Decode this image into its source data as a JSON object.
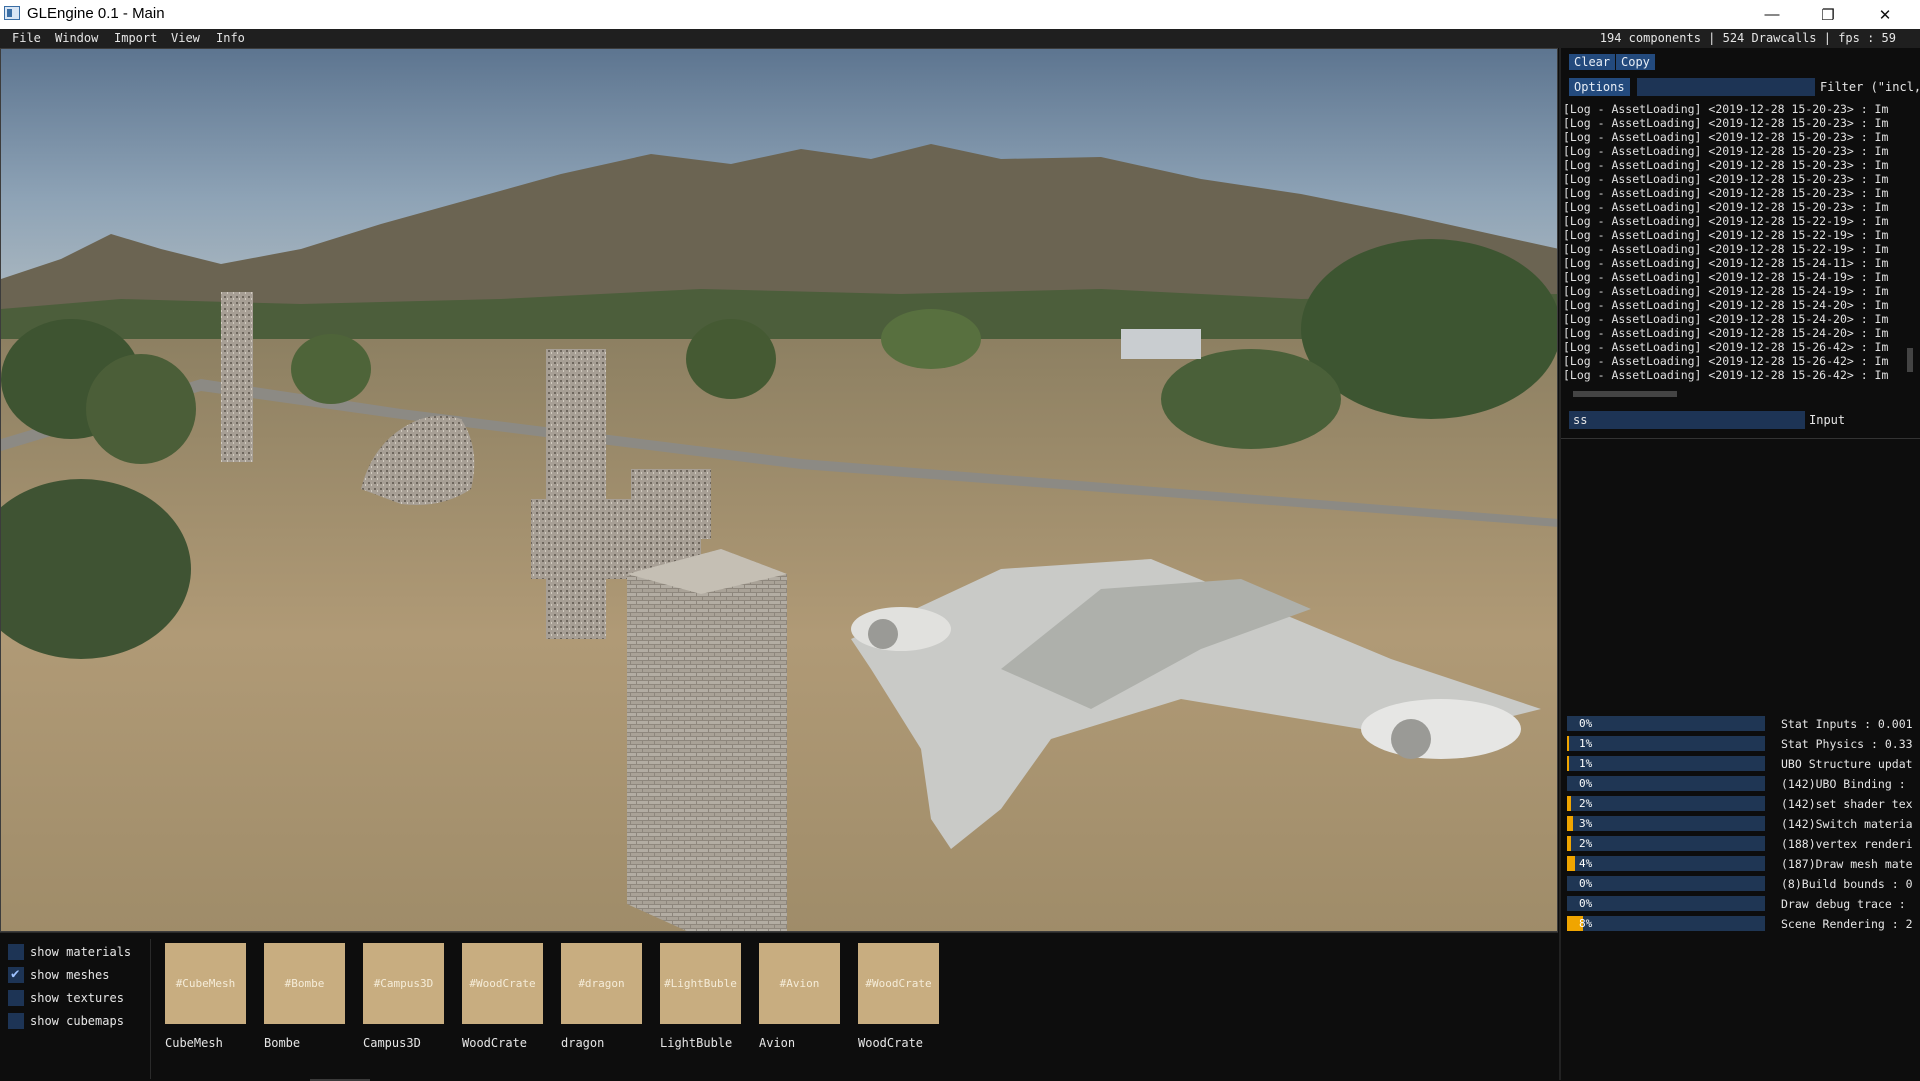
{
  "window": {
    "title": "GLEngine 0.1 - Main",
    "minimize_glyph": "—",
    "maximize_glyph": "❐",
    "close_glyph": "✕"
  },
  "menu": [
    "File",
    "Window",
    "Import",
    "View",
    "Info"
  ],
  "stats_text": "194 components | 524 Drawcalls | fps : 59",
  "console": {
    "clear_label": "Clear",
    "copy_label": "Copy",
    "options_label": "Options",
    "filter_label": "Filter (\"incl,",
    "input_value": "ss",
    "input_label": "Input",
    "lines": [
      "[Log - AssetLoading] <2019-12-28 15-20-23> : Im",
      "[Log - AssetLoading] <2019-12-28 15-20-23> : Im",
      "[Log - AssetLoading] <2019-12-28 15-20-23> : Im",
      "[Log - AssetLoading] <2019-12-28 15-20-23> : Im",
      "[Log - AssetLoading] <2019-12-28 15-20-23> : Im",
      "[Log - AssetLoading] <2019-12-28 15-20-23> : Im",
      "[Log - AssetLoading] <2019-12-28 15-20-23> : Im",
      "[Log - AssetLoading] <2019-12-28 15-20-23> : Im",
      "[Log - AssetLoading] <2019-12-28 15-22-19> : Im",
      "[Log - AssetLoading] <2019-12-28 15-22-19> : Im",
      "[Log - AssetLoading] <2019-12-28 15-22-19> : Im",
      "[Log - AssetLoading] <2019-12-28 15-24-11> : Im",
      "[Log - AssetLoading] <2019-12-28 15-24-19> : Im",
      "[Log - AssetLoading] <2019-12-28 15-24-19> : Im",
      "[Log - AssetLoading] <2019-12-28 15-24-20> : Im",
      "[Log - AssetLoading] <2019-12-28 15-24-20> : Im",
      "[Log - AssetLoading] <2019-12-28 15-24-20> : Im",
      "[Log - AssetLoading] <2019-12-28 15-26-42> : Im",
      "[Log - AssetLoading] <2019-12-28 15-26-42> : Im",
      "[Log - AssetLoading] <2019-12-28 15-26-42> : Im"
    ]
  },
  "profiler": [
    {
      "pct": "0%",
      "value": 0.0,
      "label": "Stat Inputs : 0.001"
    },
    {
      "pct": "1%",
      "value": 0.01,
      "label": "Stat Physics : 0.33"
    },
    {
      "pct": "1%",
      "value": 0.01,
      "label": "UBO Structure updat"
    },
    {
      "pct": "0%",
      "value": 0.0,
      "label": "(142)UBO Binding : "
    },
    {
      "pct": "2%",
      "value": 0.02,
      "label": "(142)set shader tex"
    },
    {
      "pct": "3%",
      "value": 0.03,
      "label": "(142)Switch materia"
    },
    {
      "pct": "2%",
      "value": 0.02,
      "label": "(188)vertex renderi"
    },
    {
      "pct": "4%",
      "value": 0.04,
      "label": "(187)Draw mesh mate"
    },
    {
      "pct": "0%",
      "value": 0.0,
      "label": "(8)Build bounds : 0"
    },
    {
      "pct": "0%",
      "value": 0.0,
      "label": "Draw debug trace : "
    },
    {
      "pct": "8%",
      "value": 0.08,
      "label": "Scene Rendering : 2"
    }
  ],
  "toggles": [
    {
      "label": "show materials",
      "checked": false
    },
    {
      "label": "show meshes",
      "checked": true
    },
    {
      "label": "show textures",
      "checked": false
    },
    {
      "label": "show cubemaps",
      "checked": false
    }
  ],
  "assets": [
    {
      "tag": "#CubeMesh",
      "name": "CubeMesh"
    },
    {
      "tag": "#Bombe",
      "name": "Bombe"
    },
    {
      "tag": "#Campus3D",
      "name": "Campus3D"
    },
    {
      "tag": "#WoodCrate",
      "name": "WoodCrate"
    },
    {
      "tag": "#dragon",
      "name": "dragon"
    },
    {
      "tag": "#LightBuble",
      "name": "LightBuble"
    },
    {
      "tag": "#Avion",
      "name": "Avion"
    },
    {
      "tag": "#WoodCrate",
      "name": "WoodCrate"
    }
  ],
  "colors": {
    "accent": "#234a7d",
    "profile_fill": "#f0a500",
    "asset_thumb": "#c8ad80",
    "panel_bg": "#0d0d0d"
  }
}
